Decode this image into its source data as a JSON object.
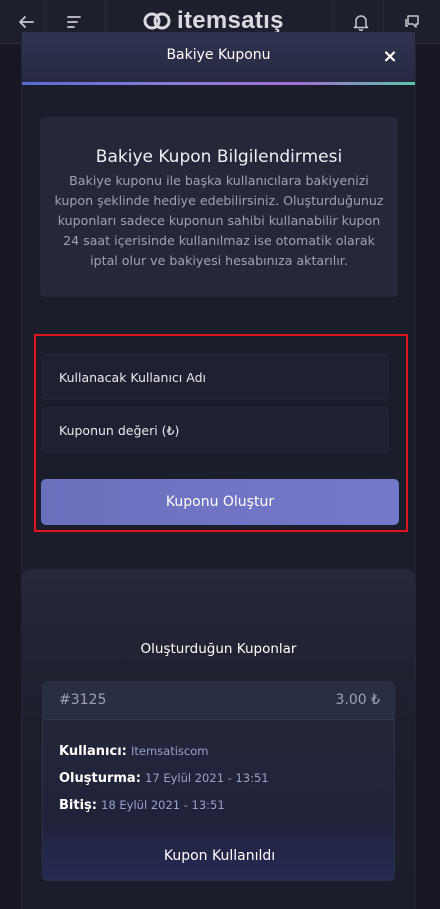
{
  "brand": {
    "name": "itemsatış"
  },
  "modal": {
    "title": "Bakiye Kuponu",
    "close_label": "×"
  },
  "info": {
    "title": "Bakiye Kupon Bilgilendirmesi",
    "text": "Bakiye kuponu ile başka kullanıcılara bakiyenizi kupon şeklinde hediye edebilirsiniz. Oluşturduğunuz kuponları sadece kuponun sahibi kullanabilir kupon 24 saat içerisinde kullanılmaz ise otomatik olarak iptal olur ve bakiyesi hesabınıza aktarılır."
  },
  "form": {
    "username_placeholder": "Kullanacak Kullanıcı Adı",
    "value_placeholder": "Kuponun değeri (₺)",
    "submit_label": "Kuponu Oluştur"
  },
  "coupons": {
    "title": "Oluşturduğun Kuponlar",
    "items": [
      {
        "id": "#3125",
        "amount": "3.00 ₺",
        "user_label": "Kullanıcı:",
        "user": "Itemsatiscom",
        "created_label": "Oluşturma:",
        "created": "17 Eylül 2021 - 13:51",
        "ends_label": "Bitiş:",
        "ends": "18 Eylül 2021 - 13:51",
        "status": "Kupon Kullanıldı"
      }
    ]
  },
  "icons": {
    "back": "arrow-left-icon",
    "menu": "menu-icon",
    "notifications": "bell-icon",
    "messages": "chat-icon"
  },
  "colors": {
    "accent": "#7478c9",
    "highlight_frame": "#e0141f",
    "background": "#14151f"
  }
}
